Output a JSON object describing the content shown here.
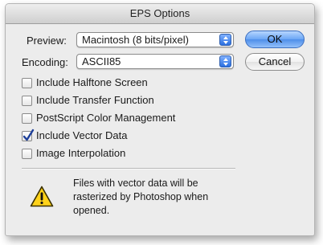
{
  "dialog": {
    "title": "EPS Options"
  },
  "preview": {
    "label": "Preview:",
    "value": "Macintosh  (8 bits/pixel)"
  },
  "encoding": {
    "label": "Encoding:",
    "value": "ASCII85"
  },
  "buttons": {
    "ok": "OK",
    "cancel": "Cancel"
  },
  "options": [
    {
      "label": "Include Halftone Screen",
      "checked": false
    },
    {
      "label": "Include Transfer Function",
      "checked": false
    },
    {
      "label": "PostScript Color Management",
      "checked": false
    },
    {
      "label": "Include Vector Data",
      "checked": true
    },
    {
      "label": "Image Interpolation",
      "checked": false
    }
  ],
  "warning": {
    "icon": "warning-icon",
    "message": "Files with vector data will be rasterized by Photoshop when opened."
  },
  "colors": {
    "default_button": "#6aa6f5",
    "popup_arrows": "#2b6fe0",
    "dialog_bg": "#ececec"
  }
}
